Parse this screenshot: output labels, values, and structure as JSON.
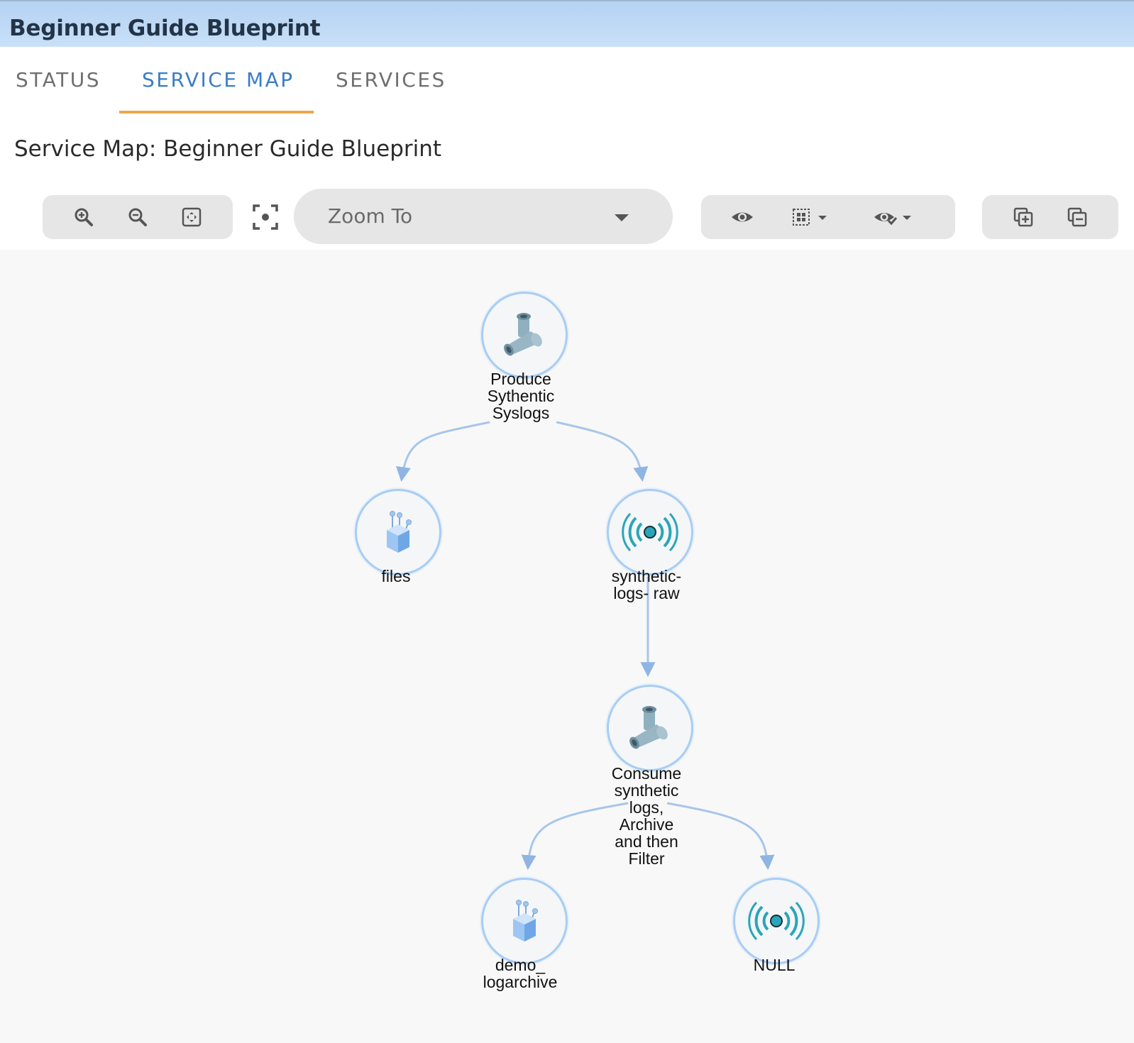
{
  "window": {
    "title": "Beginner Guide Blueprint"
  },
  "tabs": [
    {
      "label": "STATUS",
      "active": false
    },
    {
      "label": "SERVICE MAP",
      "active": true
    },
    {
      "label": "SERVICES",
      "active": false
    }
  ],
  "tab_accent_color": "#eba84a",
  "active_tab_color": "#3a7dc5",
  "page": {
    "heading": "Service Map: Beginner Guide Blueprint"
  },
  "toolbar": {
    "zoom_group": [
      "zoom-in-icon",
      "zoom-out-icon",
      "fit-to-screen-icon"
    ],
    "focus_icon": "focus-center-icon",
    "zoom_to": {
      "label": "Zoom To"
    },
    "view_group": [
      "eye-icon",
      "grid-select-icon",
      "eye-check-icon"
    ],
    "copy_group": [
      "copy-add-icon",
      "copy-remove-icon"
    ]
  },
  "service_map": {
    "nodes": [
      {
        "id": "produce",
        "label_lines": [
          "Produce",
          "Sythentic",
          "Syslogs"
        ],
        "icon": "pipe-tee-icon"
      },
      {
        "id": "files",
        "label_lines": [
          "files"
        ],
        "icon": "file-store-icon"
      },
      {
        "id": "synthetic",
        "label_lines": [
          "synthetic-",
          "logs- raw"
        ],
        "icon": "broadcast-signal-icon"
      },
      {
        "id": "consume",
        "label_lines": [
          "Consume",
          "synthetic",
          "logs,",
          "Archive",
          "and then",
          "Filter"
        ],
        "icon": "pipe-tee-icon"
      },
      {
        "id": "demo",
        "label_lines": [
          "demo_",
          "logarchive"
        ],
        "icon": "file-store-icon"
      },
      {
        "id": "null",
        "label_lines": [
          "NULL"
        ],
        "icon": "broadcast-signal-icon"
      }
    ],
    "edges": [
      {
        "from": "produce",
        "to": "files"
      },
      {
        "from": "produce",
        "to": "synthetic"
      },
      {
        "from": "synthetic",
        "to": "consume"
      },
      {
        "from": "consume",
        "to": "demo"
      },
      {
        "from": "consume",
        "to": "null"
      }
    ],
    "edge_color": "#a7c6ea",
    "node_border_color": "#a9cdf2"
  }
}
